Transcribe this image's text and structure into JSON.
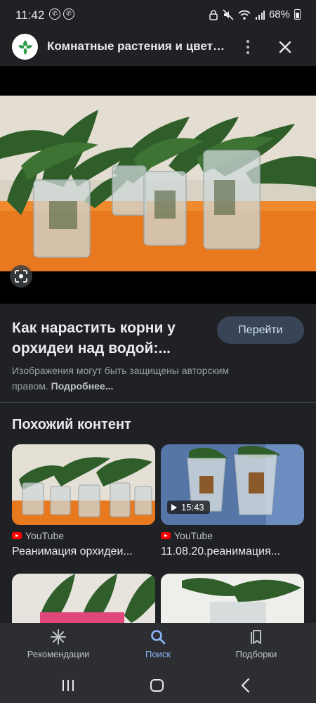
{
  "status_bar": {
    "time": "11:42",
    "battery": "68%"
  },
  "header": {
    "title": "Комнатные растения и цветы..."
  },
  "result": {
    "title_line1": "Как нарастить корни у",
    "title_line2": "орхидеи над водой:...",
    "visit_label": "Перейти",
    "copyright_text": "Изображения могут быть защищены авторским правом.",
    "more_link": "Подробнее..."
  },
  "related": {
    "heading": "Похожий контент",
    "cards": [
      {
        "source": "YouTube",
        "title": "Реанимация орхидеи...",
        "duration": ""
      },
      {
        "source": "YouTube",
        "title": "11.08.20.реанимация...",
        "duration": "15:43"
      }
    ]
  },
  "bottom_nav": {
    "items": [
      {
        "label": "Рекомендации",
        "icon": "asterisk-icon",
        "active": false
      },
      {
        "label": "Поиск",
        "icon": "search-icon",
        "active": true
      },
      {
        "label": "Подборки",
        "icon": "bookmarks-icon",
        "active": false
      }
    ]
  },
  "colors": {
    "background": "#202124",
    "accent": "#8ab4f8",
    "button_bg": "#394457",
    "youtube_red": "#ff0000"
  }
}
